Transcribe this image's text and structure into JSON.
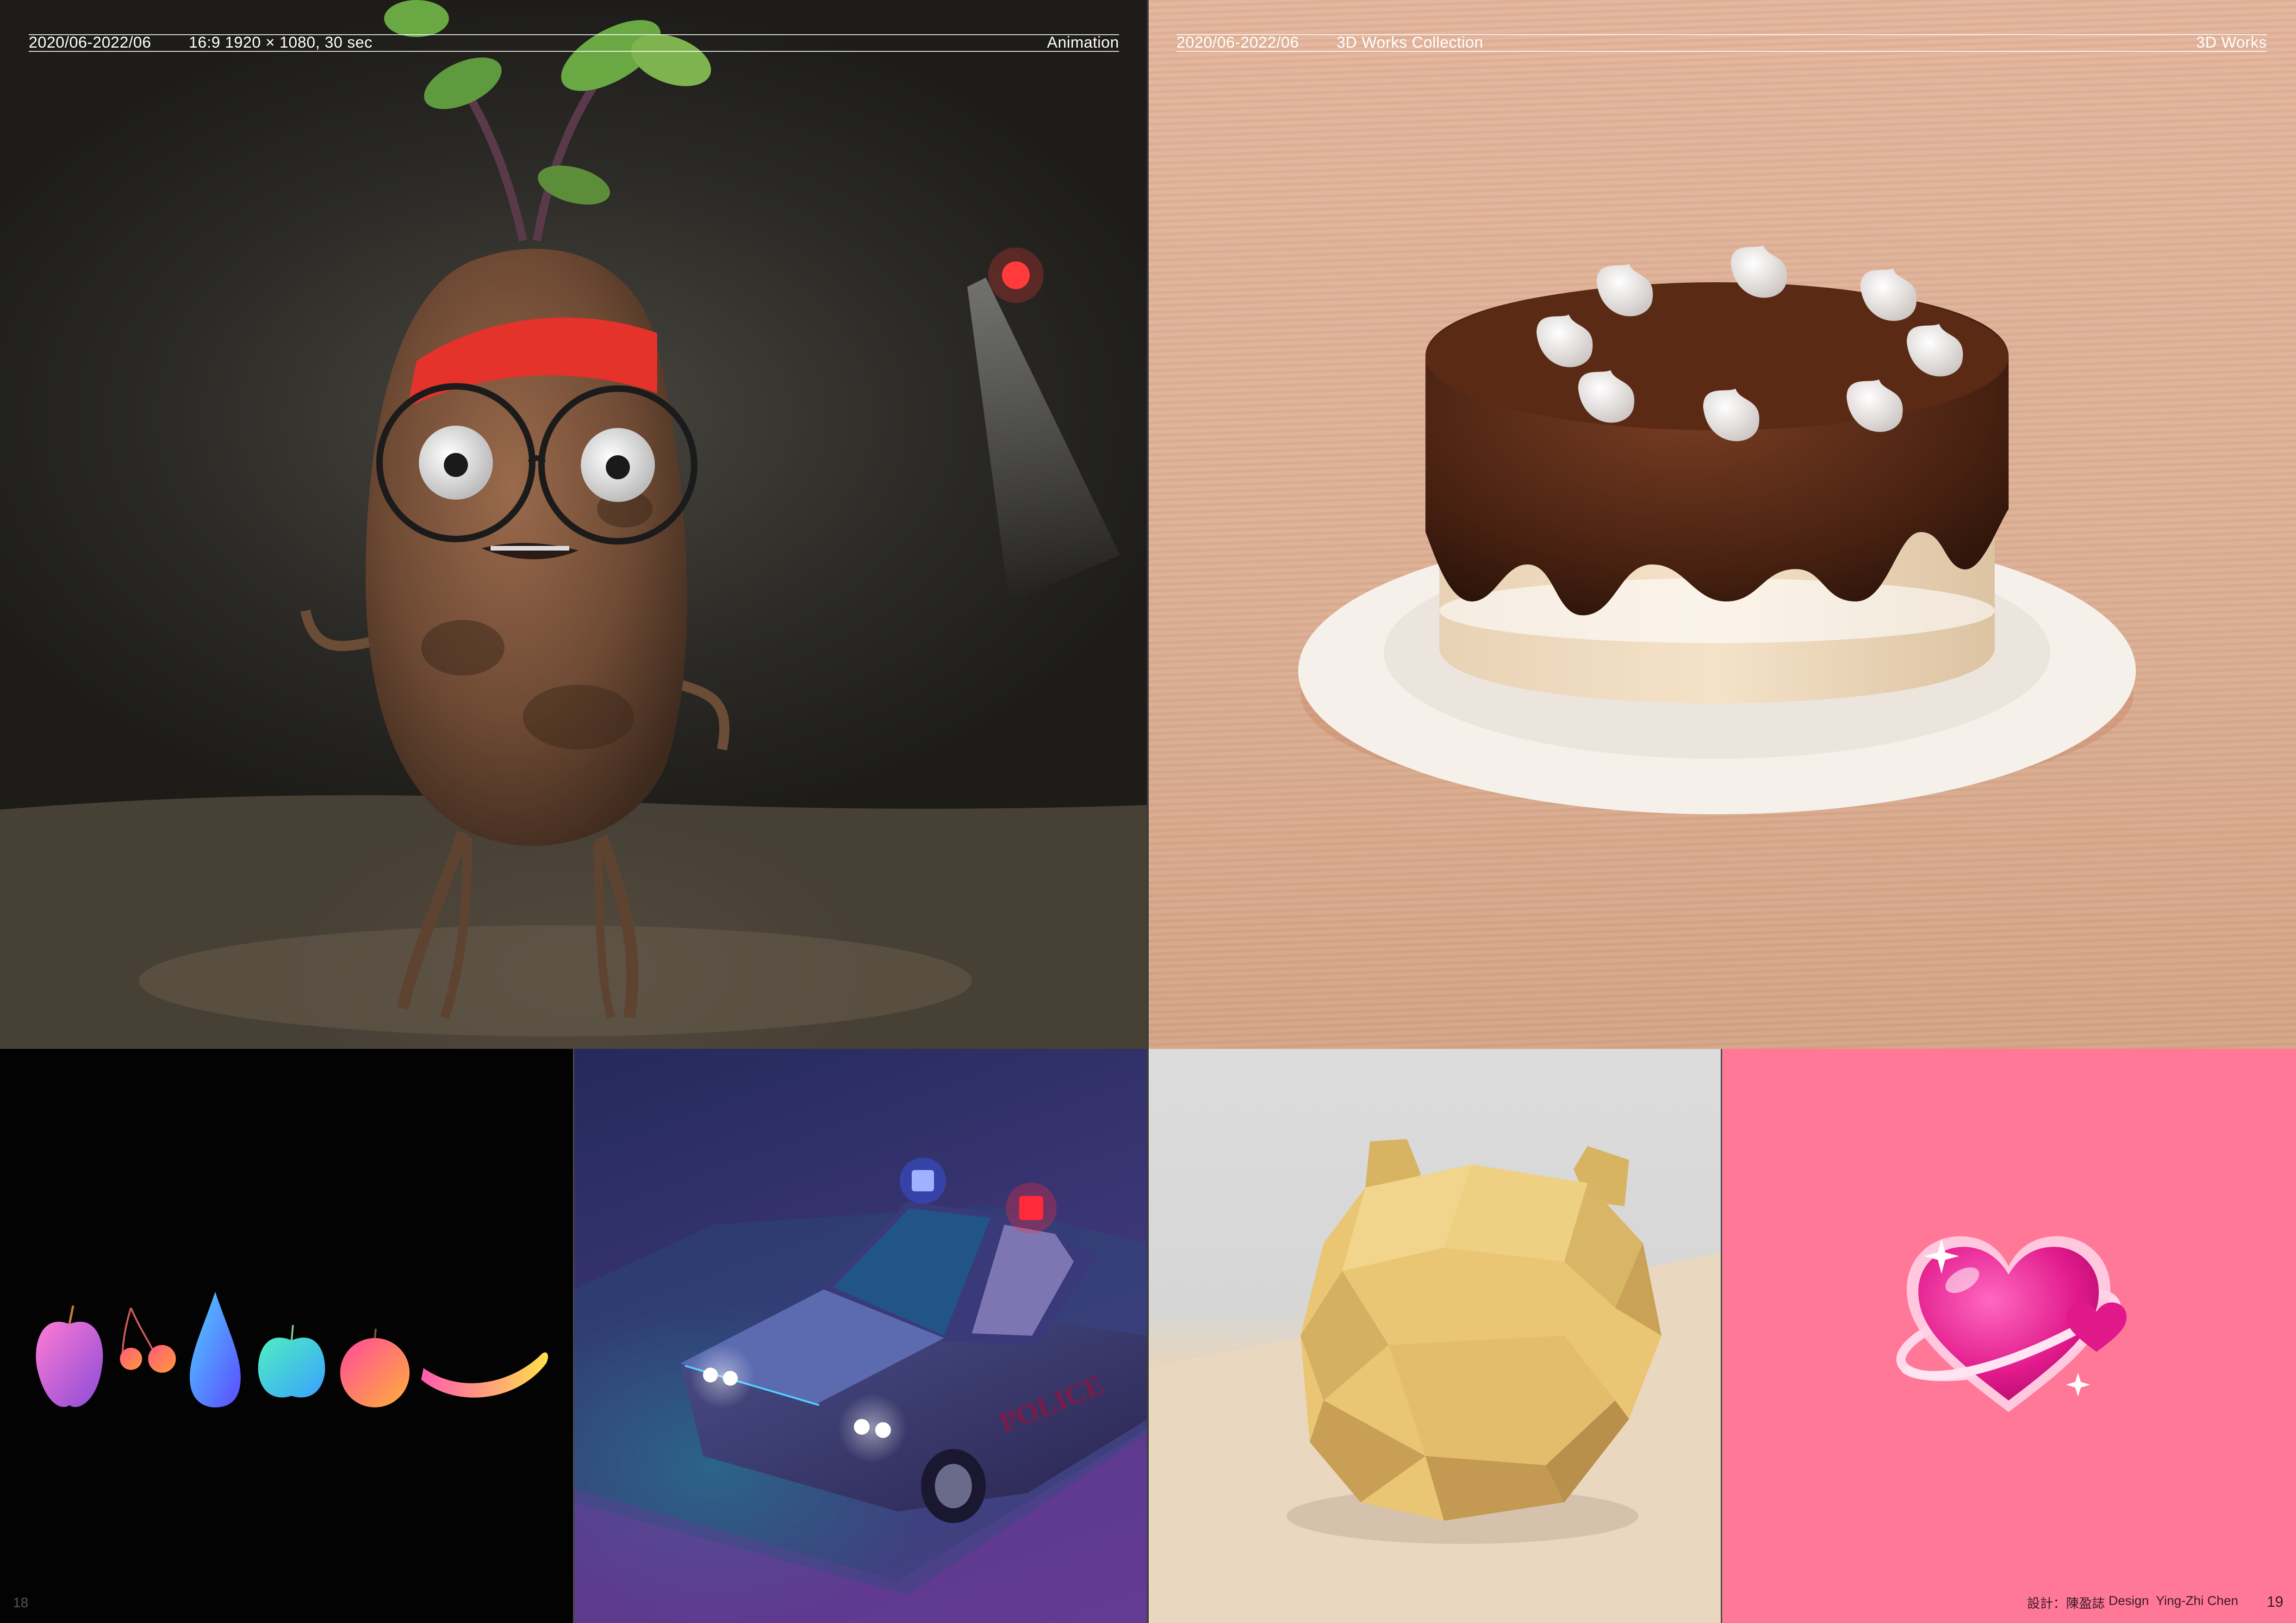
{
  "left_header": {
    "date_range": "2020/06-2022/06",
    "spec": "16:9 1920 × 1080, 30 sec",
    "category": "Animation"
  },
  "right_header": {
    "date_range": "2020/06-2022/06",
    "subtitle": "3D Works Collection",
    "category": "3D Works"
  },
  "footer": {
    "left_page_number": "18",
    "credit_chinese": "設計：陳盈誌",
    "credit_english": "Design  Ying-Zhi Chen",
    "right_page_number": "19"
  },
  "police_car_text": "POLICE",
  "colors": {
    "header_text": "#ffffff",
    "heart_background": "#ff7898",
    "fruits_background": "#030303"
  }
}
